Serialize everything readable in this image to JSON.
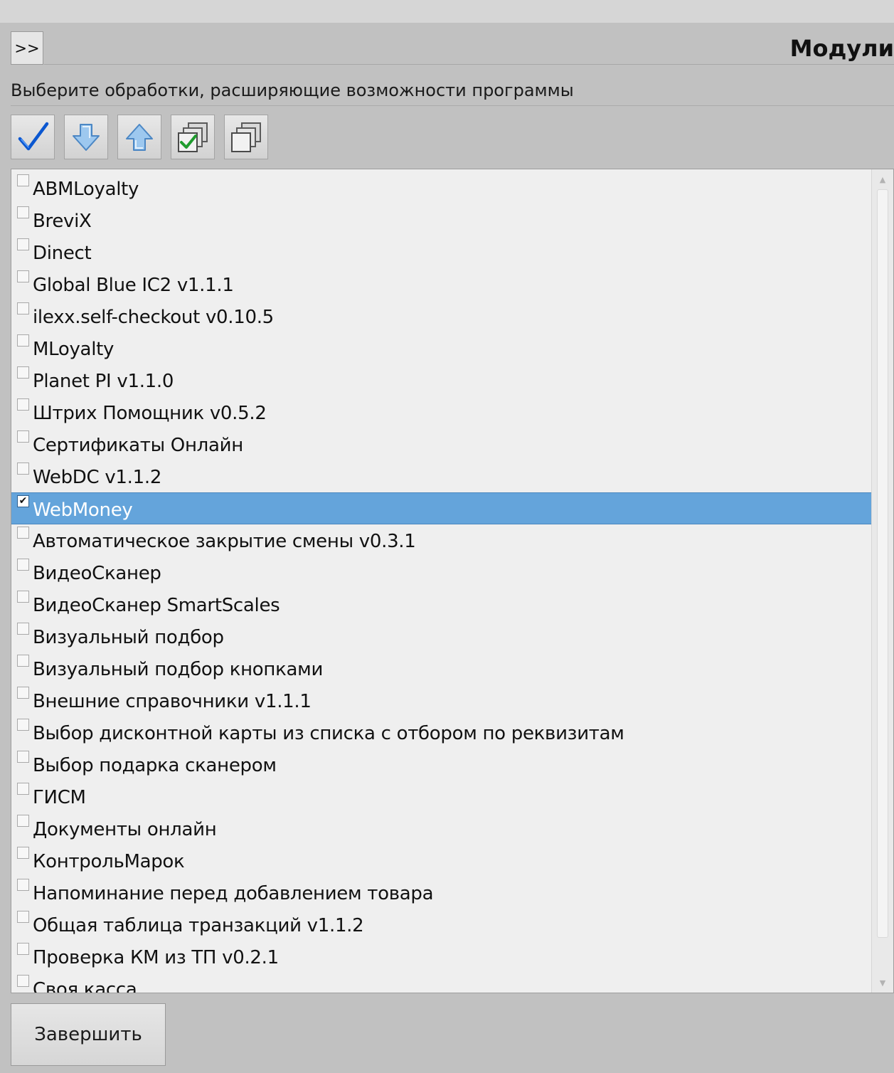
{
  "header": {
    "expand_label": ">>",
    "title": "Модули"
  },
  "subtitle": "Выберите обработки, расширяющие возможности программы",
  "toolbar": {
    "buttons": [
      {
        "icon": "checkmark-icon"
      },
      {
        "icon": "arrow-down-icon"
      },
      {
        "icon": "arrow-up-icon"
      },
      {
        "icon": "check-all-icon"
      },
      {
        "icon": "uncheck-all-icon"
      }
    ]
  },
  "list": {
    "items": [
      {
        "label": "ABMLoyalty",
        "checked": false
      },
      {
        "label": "BreviX",
        "checked": false
      },
      {
        "label": "Dinect",
        "checked": false
      },
      {
        "label": "Global Blue IC2 v1.1.1",
        "checked": false
      },
      {
        "label": "ilexx.self-checkout v0.10.5",
        "checked": false
      },
      {
        "label": "MLoyalty",
        "checked": false
      },
      {
        "label": "Planet PI v1.1.0",
        "checked": false
      },
      {
        "label": "Штрих Помощник v0.5.2",
        "checked": false
      },
      {
        "label": "Сертификаты Онлайн",
        "checked": false
      },
      {
        "label": "WebDC v1.1.2",
        "checked": false
      },
      {
        "label": "WebMoney",
        "checked": true
      },
      {
        "label": "Автоматическое закрытие смены v0.3.1",
        "checked": false
      },
      {
        "label": "ВидеоСканер",
        "checked": false
      },
      {
        "label": "ВидеоСканер SmartScales",
        "checked": false
      },
      {
        "label": "Визуальный подбор",
        "checked": false
      },
      {
        "label": "Визуальный подбор кнопками",
        "checked": false
      },
      {
        "label": "Внешние справочники v1.1.1",
        "checked": false
      },
      {
        "label": "Выбор дисконтной карты из списка с отбором по реквизитам",
        "checked": false
      },
      {
        "label": "Выбор подарка сканером",
        "checked": false
      },
      {
        "label": "ГИСМ",
        "checked": false
      },
      {
        "label": "Документы онлайн",
        "checked": false
      },
      {
        "label": "КонтрольМарок",
        "checked": false
      },
      {
        "label": "Напоминание перед добавлением товара",
        "checked": false
      },
      {
        "label": "Общая таблица транзакций v1.1.2",
        "checked": false
      },
      {
        "label": "Проверка КМ из ТП v0.2.1",
        "checked": false
      },
      {
        "label": "Своя касса",
        "checked": false
      }
    ]
  },
  "footer": {
    "finish_label": "Завершить"
  },
  "colors": {
    "background": "#c1c1c1",
    "list_background": "#efefef",
    "selection": "#64a4db"
  }
}
